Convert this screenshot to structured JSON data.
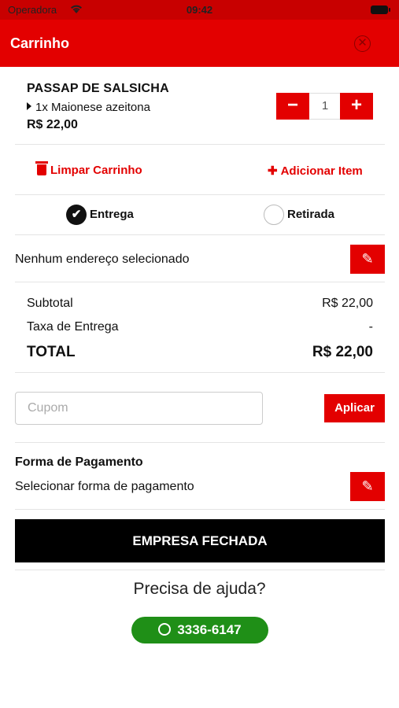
{
  "status_bar": {
    "carrier": "Operadora",
    "time": "09:42"
  },
  "header": {
    "title": "Carrinho",
    "close_glyph": "✕"
  },
  "cart_item": {
    "name": "PASSAP DE SALSICHA",
    "option": "1x Maionese azeitona",
    "price": "R$ 22,00",
    "quantity": "1"
  },
  "actions": {
    "clear_label": "Limpar Carrinho",
    "add_label": "Adicionar Item"
  },
  "delivery": {
    "delivery_label": "Entrega",
    "pickup_label": "Retirada",
    "selected": "Entrega"
  },
  "address": {
    "text": "Nenhum endereço selecionado"
  },
  "summary": {
    "subtotal_label": "Subtotal",
    "subtotal_value": "R$ 22,00",
    "fee_label": "Taxa de Entrega",
    "fee_value": "-",
    "total_label": "TOTAL",
    "total_value": "R$ 22,00"
  },
  "coupon": {
    "placeholder": "Cupom",
    "value": "",
    "apply_label": "Aplicar"
  },
  "payment": {
    "title": "Forma de Pagamento",
    "select_label": "Selecionar forma de pagamento"
  },
  "checkout": {
    "status_label": "EMPRESA FECHADA"
  },
  "help": {
    "title": "Precisa de ajuda?",
    "whatsapp": "3336-6147"
  },
  "colors": {
    "primary": "#e30000",
    "whatsapp": "#1f8f17",
    "closed": "#000000"
  },
  "icons": {
    "close": "close-icon",
    "edit": "edit-icon",
    "trash": "trash-icon",
    "plus": "plus-icon",
    "minus": "minus-icon",
    "check": "check-icon",
    "whatsapp": "whatsapp-icon"
  }
}
